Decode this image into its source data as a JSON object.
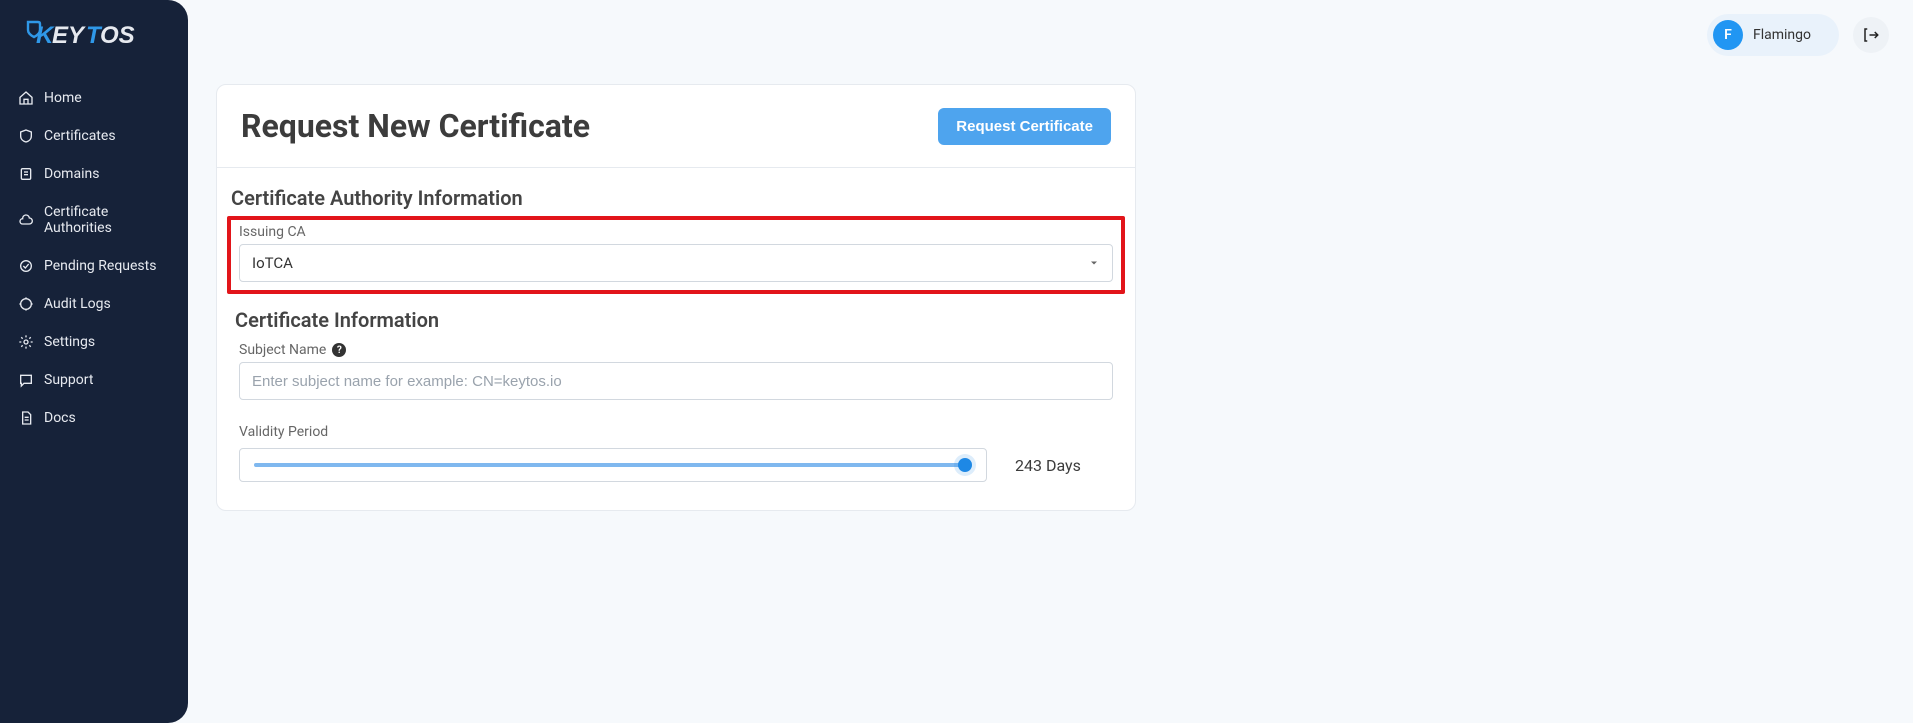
{
  "brand": {
    "name": "KEYTOS"
  },
  "sidebar": {
    "items": [
      {
        "label": "Home"
      },
      {
        "label": "Certificates"
      },
      {
        "label": "Domains"
      },
      {
        "label": "Certificate Authorities"
      },
      {
        "label": "Pending Requests"
      },
      {
        "label": "Audit Logs"
      },
      {
        "label": "Settings"
      },
      {
        "label": "Support"
      },
      {
        "label": "Docs"
      }
    ]
  },
  "topbar": {
    "user_initial": "F",
    "user_name": "Flamingo"
  },
  "page": {
    "title": "Request New Certificate",
    "request_button": "Request Certificate",
    "sections": {
      "ca_info": {
        "title": "Certificate Authority Information",
        "issuing_ca_label": "Issuing CA",
        "issuing_ca_value": "IoTCA"
      },
      "cert_info": {
        "title": "Certificate Information",
        "subject_label": "Subject Name",
        "subject_placeholder": "Enter subject name for example: CN=keytos.io",
        "validity_label": "Validity Period",
        "validity_value_text": "243 Days",
        "validity_percent": 99
      }
    }
  }
}
